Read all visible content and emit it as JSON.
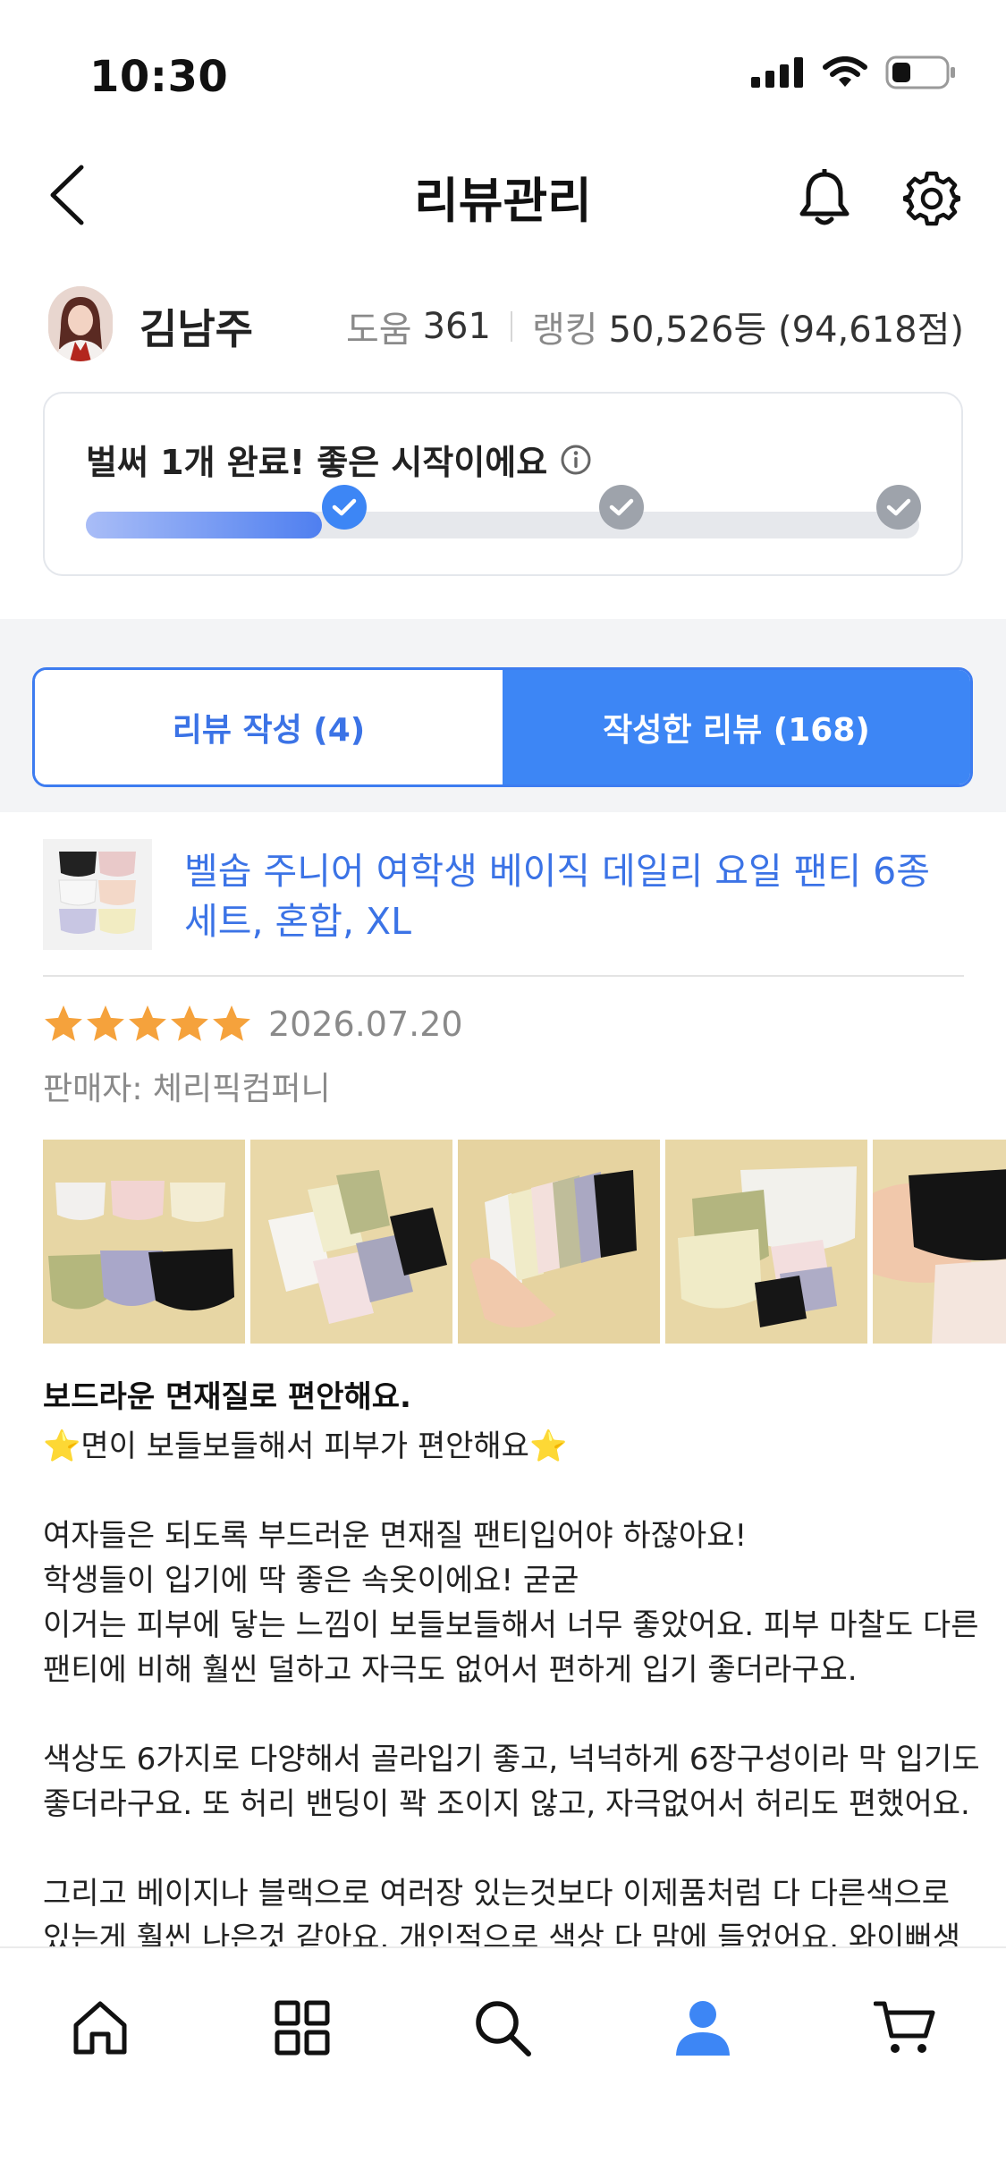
{
  "status_bar": {
    "time": "10:30"
  },
  "header": {
    "title": "리뷰관리"
  },
  "profile": {
    "name": "김남주",
    "help_label": "도움",
    "help_value": "361",
    "rank_label": "랭킹",
    "rank_value": "50,526등 (94,618점)"
  },
  "progress": {
    "message": "벌써 1개 완료! 좋은 시작이에요",
    "completed_steps": 1,
    "total_steps": 3
  },
  "tabs": {
    "write_label": "리뷰 작성 (4)",
    "written_label": "작성한 리뷰 (168)",
    "active": "written"
  },
  "product": {
    "name": "벨솝 주니어 여학생 베이직 데일리 요일 팬티 6종 세트, 혼합, XL"
  },
  "review": {
    "rating": 5,
    "date": "2026.07.20",
    "seller": "판매자: 체리픽컴퍼니",
    "title": "보드라운 면재질로 편안해요.",
    "body": "⭐면이 보들보들해서 피부가 편안해요⭐\n\n여자들은 되도록 부드러운 면재질 팬티입어야 하잖아요!\n학생들이 입기에 딱 좋은 속옷이에요! 굳굳\n이거는 피부에 닿는 느낌이 보들보들해서 너무 좋았어요. 피부 마찰도 다른\n팬티에 비해 훨씬 덜하고 자극도 없어서 편하게 입기 좋더라구요.\n\n색상도 6가지로 다양해서 골라입기 좋고, 넉넉하게 6장구성이라 막 입기도\n좋더라구요. 또 허리 밴딩이 꽉 조이지 않고, 자극없어서 허리도 편했어요.\n\n그리고 베이지나 블랙으로 여러장 있는것보다 이제품처럼 다 다른색으로\n있는게 훨씬 나은것 같아요. 개인적으로 색상 다 맘에 들었어요. 와이뻐생"
  },
  "colors": {
    "accent": "#3d86f5",
    "link": "#3b73e6",
    "star": "#f5a23c"
  },
  "icons": {
    "nav": [
      "home-icon",
      "category-grid-icon",
      "search-icon",
      "my-profile-icon",
      "cart-icon"
    ],
    "active_nav": "my-profile-icon"
  }
}
